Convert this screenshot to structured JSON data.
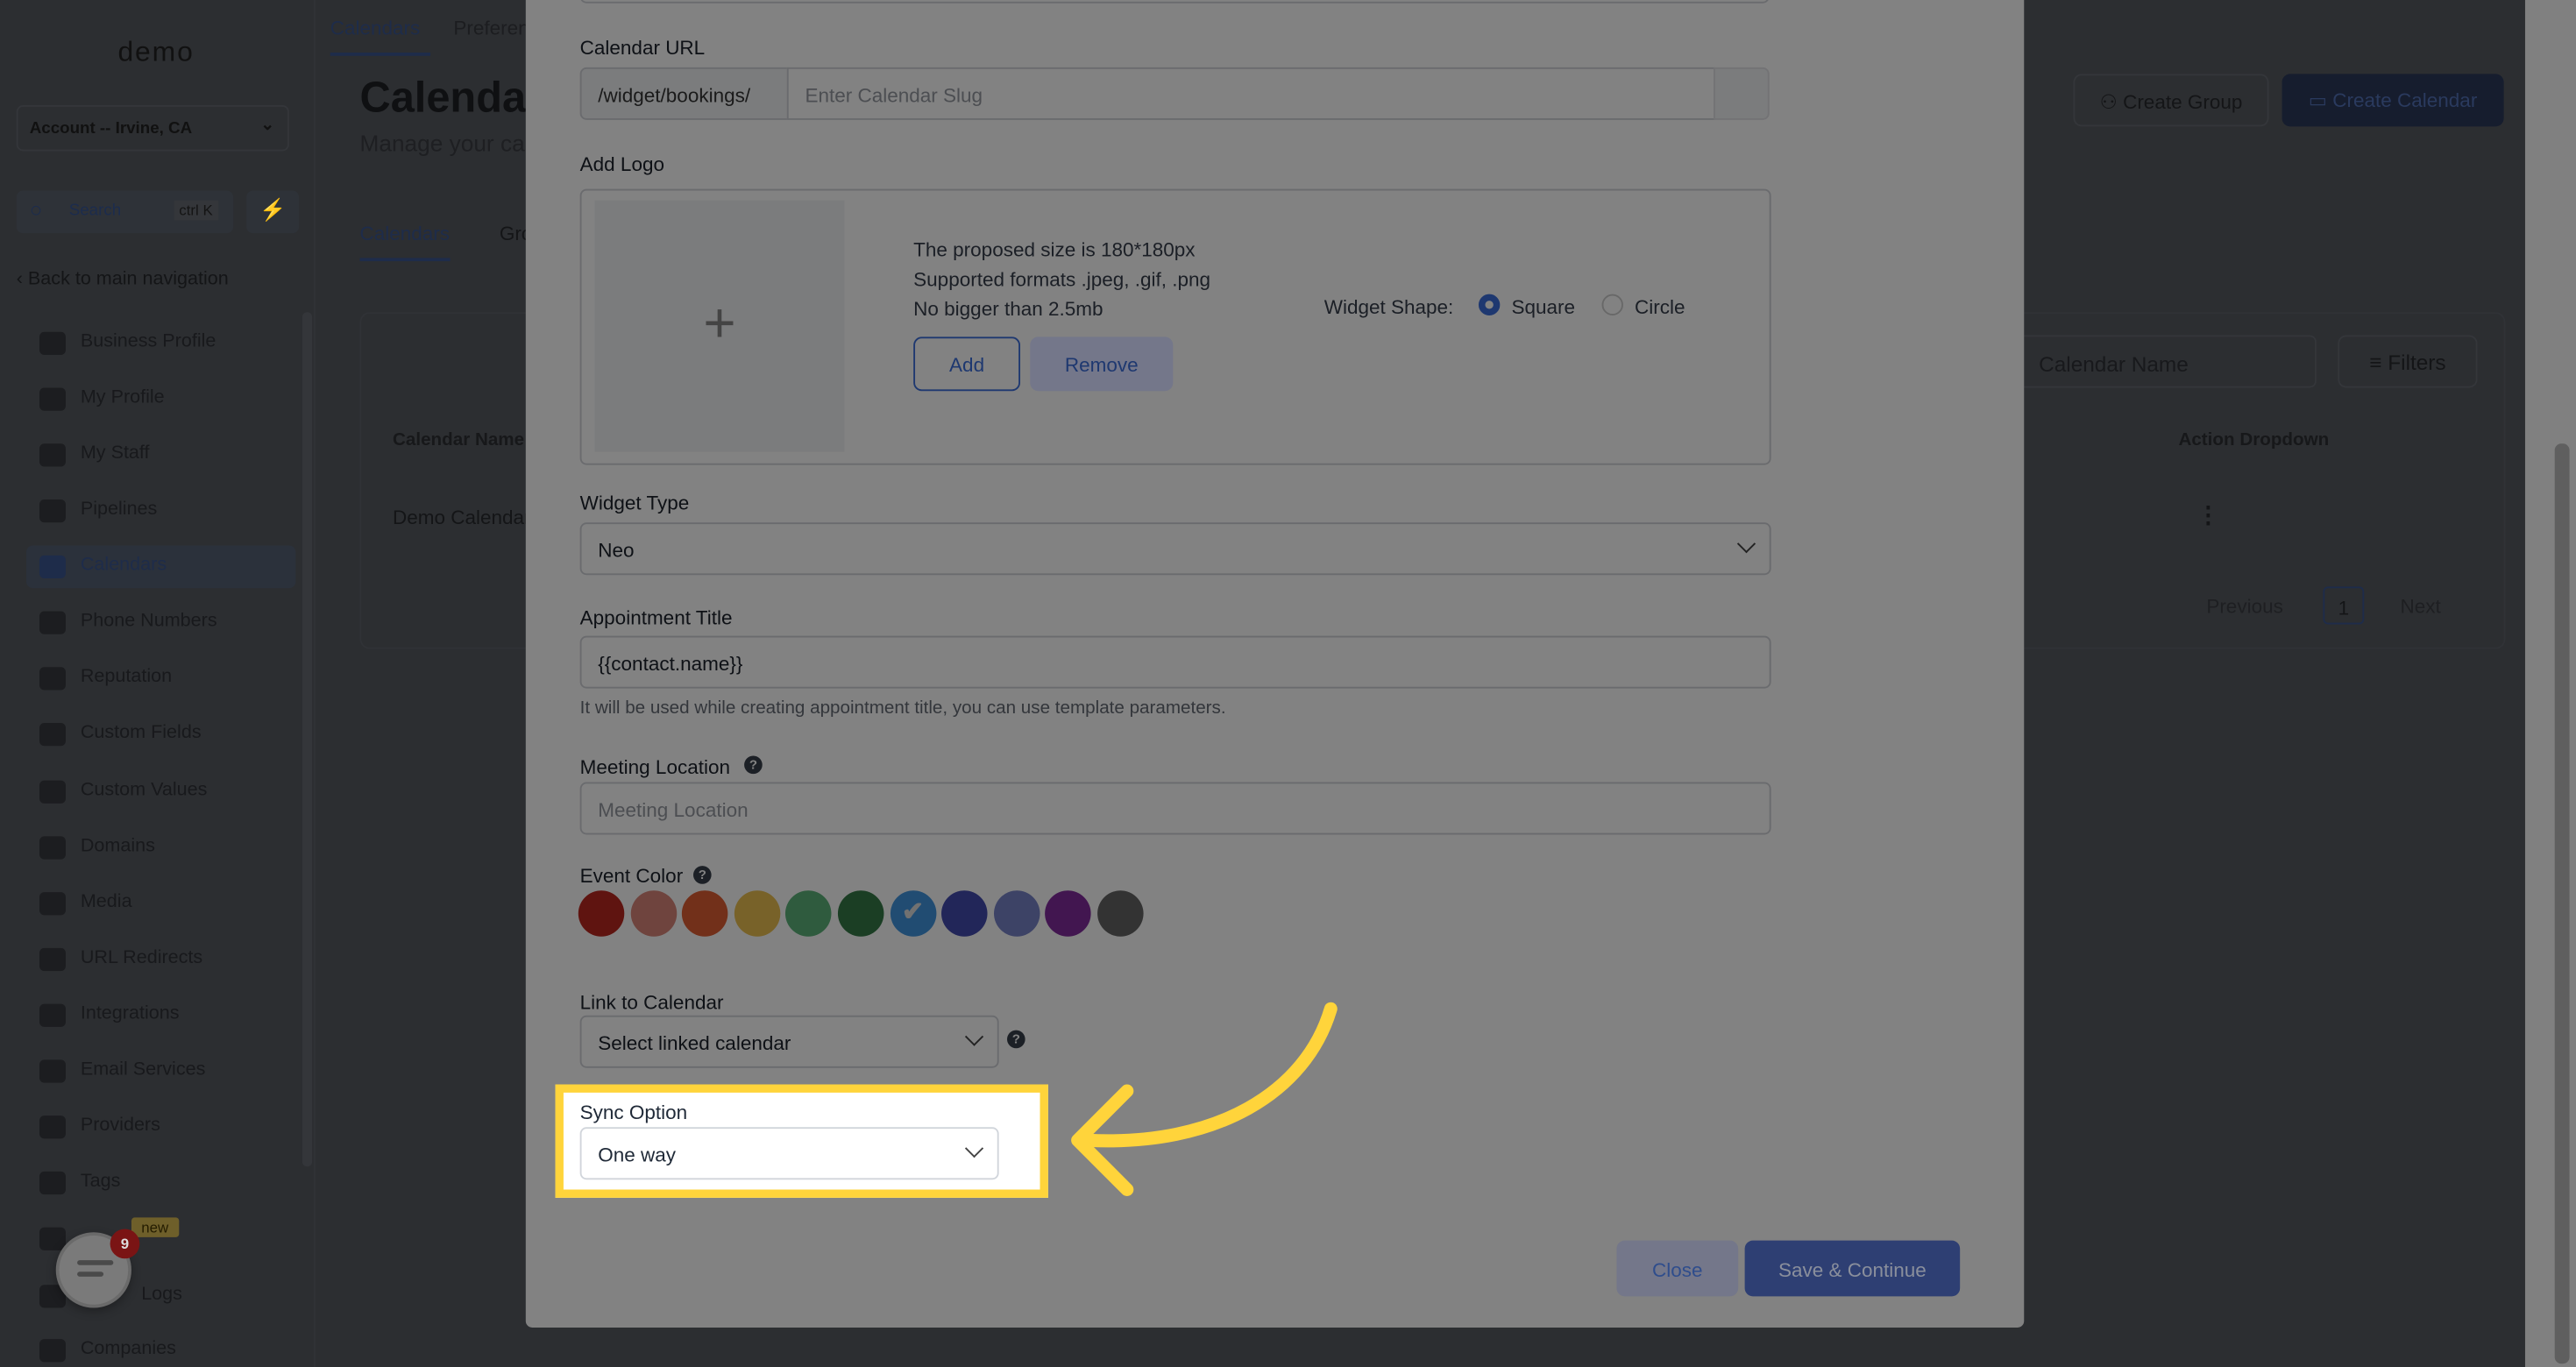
{
  "sidebar": {
    "logo": "demo",
    "account": "Account -- Irvine, CA",
    "search_label": "Search",
    "search_shortcut": "ctrl K",
    "back": "Back to main navigation",
    "items": [
      {
        "label": "Business Profile",
        "icon": "briefcase-icon"
      },
      {
        "label": "My Profile",
        "icon": "user-circle-icon"
      },
      {
        "label": "My Staff",
        "icon": "users-icon"
      },
      {
        "label": "Pipelines",
        "icon": "filter-icon"
      },
      {
        "label": "Calendars",
        "icon": "calendar-icon",
        "active": true
      },
      {
        "label": "Phone Numbers",
        "icon": "phone-icon"
      },
      {
        "label": "Reputation",
        "icon": "star-icon"
      },
      {
        "label": "Custom Fields",
        "icon": "fields-icon"
      },
      {
        "label": "Custom Values",
        "icon": "tag-icon"
      },
      {
        "label": "Domains",
        "icon": "globe-icon"
      },
      {
        "label": "Media",
        "icon": "media-icon"
      },
      {
        "label": "URL Redirects",
        "icon": "redirect-icon"
      },
      {
        "label": "Integrations",
        "icon": "integrations-icon"
      },
      {
        "label": "Email Services",
        "icon": "mail-icon"
      },
      {
        "label": "Providers",
        "icon": "provider-icon"
      },
      {
        "label": "Tags",
        "icon": "tag-icon"
      },
      {
        "label": "",
        "icon": "stack-icon"
      },
      {
        "label": "Logs",
        "icon": "chart-icon"
      },
      {
        "label": "Companies",
        "icon": "folder-icon"
      }
    ],
    "new_badge": "new",
    "chat_badge": "9"
  },
  "page": {
    "top_tabs": [
      "Calendars",
      "Preferences"
    ],
    "title": "Calendars",
    "subtitle": "Manage your calendars",
    "tabs": [
      "Calendars",
      "Groups"
    ],
    "create_group": "Create Group",
    "create_calendar": "Create Calendar",
    "search_placeholder": "Calendar Name",
    "filters": "Filters",
    "columns": [
      "Calendar Name",
      "Action Dropdown"
    ],
    "rows": [
      {
        "name": "Demo Calendar"
      }
    ],
    "pagination": {
      "previous": "Previous",
      "page": "1",
      "next": "Next"
    }
  },
  "modal": {
    "calendar_url": {
      "label": "Calendar URL",
      "prefix": "/widget/bookings/",
      "placeholder": "Enter Calendar Slug"
    },
    "logo": {
      "label": "Add Logo",
      "info": [
        "The proposed size is 180*180px",
        "Supported formats .jpeg, .gif, .png",
        "No bigger than 2.5mb"
      ],
      "add": "Add",
      "remove": "Remove",
      "shape_label": "Widget Shape:",
      "shapes": [
        "Square",
        "Circle"
      ],
      "selected_shape": "Square"
    },
    "widget_type": {
      "label": "Widget Type",
      "value": "Neo"
    },
    "appointment_title": {
      "label": "Appointment Title",
      "value": "{{contact.name}}",
      "help": "It will be used while creating appointment title, you can use template parameters."
    },
    "meeting_location": {
      "label": "Meeting Location",
      "placeholder": "Meeting Location"
    },
    "event_color": {
      "label": "Event Color",
      "colors": [
        "#BA271F",
        "#D9867A",
        "#E05E33",
        "#EBC050",
        "#5CB27A",
        "#357A47",
        "#4196E0",
        "#424AAE",
        "#7883C8",
        "#812B9D",
        "#646464"
      ],
      "selected_index": 6,
      "check": "✔"
    },
    "link_calendar": {
      "label": "Link to Calendar",
      "value": "Select linked calendar"
    },
    "sync_option": {
      "label": "Sync Option",
      "value": "One way"
    },
    "close": "Close",
    "save": "Save & Continue"
  },
  "highlight_color": "#FFD43B",
  "accent": "#3B6FD6"
}
